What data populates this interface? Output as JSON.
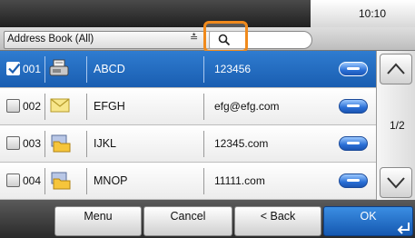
{
  "status": {
    "time": "10:10"
  },
  "filter": {
    "label": "Address Book (All)"
  },
  "search": {
    "icon": "search-icon"
  },
  "entries": [
    {
      "number": "001",
      "type": "fax",
      "name": "ABCD",
      "address": "123456",
      "selected": true
    },
    {
      "number": "002",
      "type": "email",
      "name": "EFGH",
      "address": "efg@efg.com",
      "selected": false
    },
    {
      "number": "003",
      "type": "folder",
      "name": "IJKL",
      "address": "12345.com",
      "selected": false
    },
    {
      "number": "004",
      "type": "folder",
      "name": "MNOP",
      "address": "11111.com",
      "selected": false
    }
  ],
  "pagination": {
    "indicator": "1/2"
  },
  "buttons": {
    "menu": "Menu",
    "cancel": "Cancel",
    "back": "< Back",
    "ok": "OK"
  },
  "colors": {
    "selected_row": "#1a5eb1",
    "highlight": "#f08a1c",
    "ok_button": "#1558b0"
  }
}
